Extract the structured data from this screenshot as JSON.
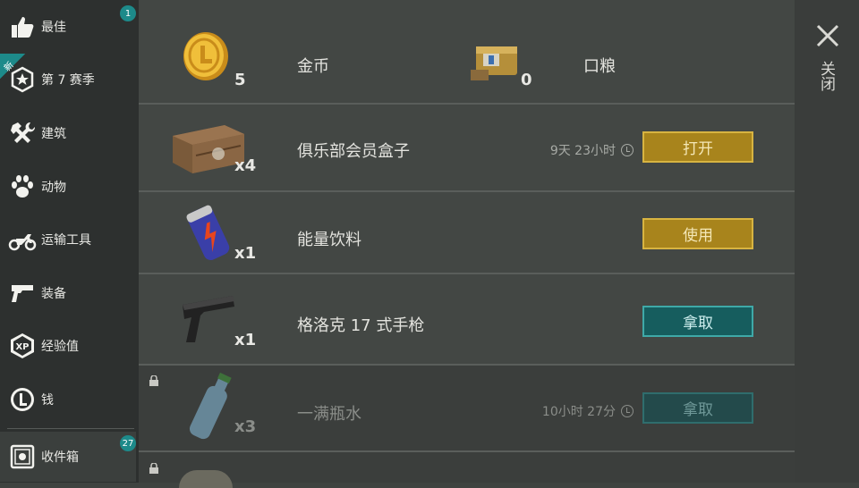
{
  "sidebar": {
    "items": [
      {
        "label": "最佳",
        "icon": "thumbs-up-icon",
        "badge": "1"
      },
      {
        "label": "第 7 赛季",
        "icon": "season-star-icon",
        "ribbon": "新"
      },
      {
        "label": "建筑",
        "icon": "hammer-wrench-icon"
      },
      {
        "label": "动物",
        "icon": "paw-icon"
      },
      {
        "label": "运输工具",
        "icon": "motorcycle-icon"
      },
      {
        "label": "装备",
        "icon": "pistol-icon"
      },
      {
        "label": "经验值",
        "icon": "xp-icon"
      },
      {
        "label": "钱",
        "icon": "coin-icon"
      },
      {
        "label": "收件箱",
        "icon": "inbox-safe-icon",
        "badge": "27",
        "active": true
      }
    ]
  },
  "currency": {
    "coins": {
      "label": "金币",
      "count": "5",
      "icon": "gold-coin-icon"
    },
    "rations": {
      "label": "口粮",
      "count": "0",
      "icon": "ration-can-icon"
    }
  },
  "items": [
    {
      "name": "俱乐部会员盒子",
      "qty": "x4",
      "timer": "9天 23小时",
      "button": "打开",
      "style": "gold",
      "icon": "wooden-crate-icon",
      "locked": false
    },
    {
      "name": "能量饮料",
      "qty": "x1",
      "timer": "",
      "button": "使用",
      "style": "gold",
      "icon": "energy-drink-icon",
      "locked": false
    },
    {
      "name": "格洛克 17 式手枪",
      "qty": "x1",
      "timer": "",
      "button": "拿取",
      "style": "teal",
      "icon": "pistol-icon",
      "locked": false
    },
    {
      "name": "一满瓶水",
      "qty": "x3",
      "timer": "10小时 27分",
      "button": "拿取",
      "style": "teal-dim",
      "icon": "water-bottle-icon",
      "locked": true
    }
  ],
  "close": {
    "label": "关闭",
    "icon": "close-icon"
  },
  "colors": {
    "accent_teal": "#1d8a8a",
    "button_gold": "#a8841c",
    "sidebar_bg": "#2d302f",
    "panel_bg": "#434744"
  }
}
